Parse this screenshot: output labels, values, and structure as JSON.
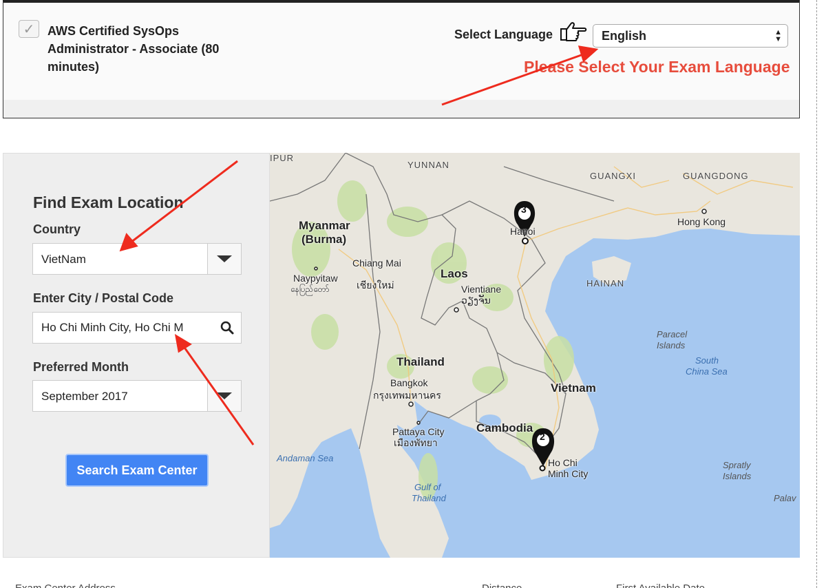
{
  "exam": {
    "name": "AWS Certified SysOps Administrator - Associate (80 minutes)",
    "checked": true
  },
  "language": {
    "label": "Select Language",
    "selected": "English",
    "note": "Please Select Your Exam Language"
  },
  "find": {
    "title": "Find Exam Location",
    "country_label": "Country",
    "country_value": "VietNam",
    "city_label": "Enter City / Postal Code",
    "city_value": "Ho Chi Minh City, Ho Chi M",
    "month_label": "Preferred Month",
    "month_value": "September 2017",
    "search_button": "Search Exam Center"
  },
  "map": {
    "regions": [
      "YUNNAN",
      "GUANGXI",
      "GUANGDONG",
      "HAINAN",
      "IPUR"
    ],
    "countries": [
      "Myanmar",
      "(Burma)",
      "Laos",
      "Thailand",
      "Cambodia",
      "Vietnam"
    ],
    "cities": [
      "Hong Kong",
      "Hanoi",
      "Chiang Mai",
      "เชียงใหม่",
      "Naypyitaw",
      "နေပြည်တော်",
      "Vientiane",
      "ວຽງຈັນ",
      "Bangkok",
      "กรุงเทพมหานคร",
      "Pattaya City",
      "เมืองพัทยา",
      "Ho Chi",
      "Minh City"
    ],
    "seas": [
      "Andaman Sea",
      "Gulf of",
      "Thailand",
      "South",
      "China Sea",
      "Paracel",
      "Islands",
      "Spratly",
      "Islands",
      "Palav"
    ],
    "markers": [
      "3",
      "2"
    ]
  },
  "table": {
    "col_address": "Exam Center Address",
    "col_distance": "Distance",
    "col_date": "First Available Date"
  },
  "colors": {
    "accent": "#4285f4",
    "note": "#e74c3c",
    "arrow": "#ee2b1e",
    "water": "#a6c8f0",
    "land": "#e9e6de"
  },
  "icons": {
    "hand": "pointing-hand-icon",
    "search": "search-icon",
    "check": "check-icon",
    "marker": "map-marker-icon"
  }
}
